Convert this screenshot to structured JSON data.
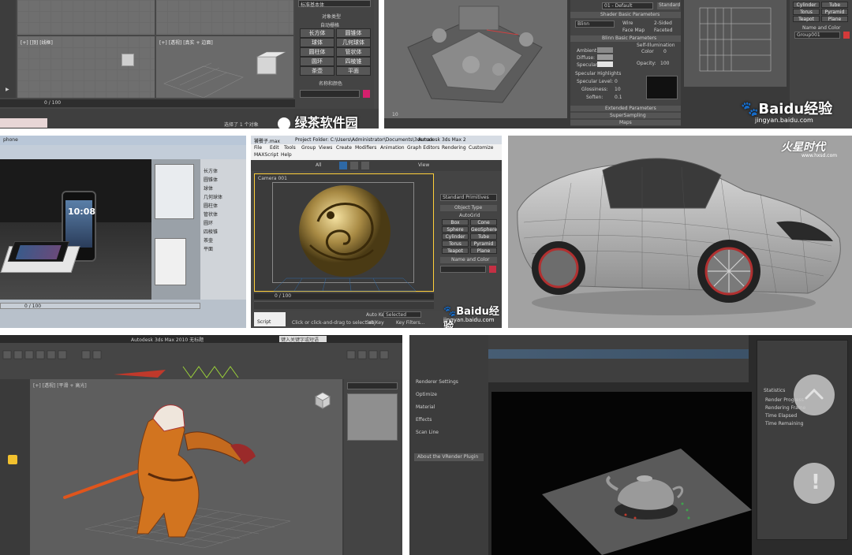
{
  "tile1": {
    "dropdown_value": "标准基本体",
    "section_object_type": "对象类型",
    "autogrid_label": "自动栅格",
    "buttons": [
      "长方体",
      "圆锥体",
      "球体",
      "几何球体",
      "圆柱体",
      "管状体",
      "圆环",
      "四棱锥",
      "茶壶",
      "平面"
    ],
    "section_name_color": "名称和颜色",
    "viewport_label_top": "[+] [顶] [线框]",
    "viewport_label_persp": "[+] [透视] [真实 + 边面]",
    "timeline": "0 / 100",
    "status": "选择了 1 个对象",
    "watermark": "绿茶软件园"
  },
  "tile2": {
    "default_label": "01 - Default",
    "standard_label": "Standard",
    "shader_header": "Shader Basic Parameters",
    "shader_value": "Blinn",
    "wire": "Wire",
    "two_sided": "2-Sided",
    "face_map": "Face Map",
    "faceted": "Faceted",
    "blinn_header": "Blinn Basic Parameters",
    "self_illum": "Self-Illumination",
    "color": "Color",
    "color_val": "0",
    "ambient": "Ambient:",
    "diffuse": "Diffuse:",
    "specular": "Specular:",
    "opacity": "Opacity:",
    "opacity_val": "100",
    "spec_highlights": "Specular Highlights",
    "spec_level": "Specular Level:",
    "spec_level_val": "0",
    "glossiness": "Glossiness:",
    "glossiness_val": "10",
    "soften": "Soften:",
    "soften_val": "0.1",
    "extended": "Extended Parameters",
    "supersampling": "SuperSampling",
    "maps": "Maps",
    "right_items": [
      "Cylinder",
      "Tube",
      "Torus",
      "Pyramid",
      "Teapot",
      "Plane"
    ],
    "right_cone": "Cone",
    "name_color": "Name and Color",
    "group_name": "Group001",
    "watermark_main": "Baidu经验",
    "watermark_url": "jingyan.baidu.com"
  },
  "tile3": {
    "title": "phone",
    "phone_time": "10:08",
    "menu_items": [
      "长方体",
      "圆锥体",
      "球体",
      "几何球体",
      "圆柱体",
      "管状体",
      "圆环",
      "四棱锥",
      "茶壶",
      "平面"
    ],
    "frame": "0 / 100"
  },
  "tile4": {
    "title_file": "饕餮子.max",
    "title_path": "Project Folder: C:\\Users\\Administrator\\Documents\\3dsmax",
    "title_app": "Autodesk 3ds Max 2",
    "menu": [
      "File",
      "Edit",
      "Tools",
      "Group",
      "Views",
      "Create",
      "Modifiers",
      "Animation",
      "Graph Editors",
      "Rendering",
      "Customize"
    ],
    "menu2": [
      "MAXScript",
      "Help"
    ],
    "toolbar_all": "All",
    "toolbar_view": "View",
    "viewport_label": "Camera 001",
    "dropdown": "Standard Primitives",
    "object_type": "Object Type",
    "autogrid": "AutoGrid",
    "primitives": [
      "Box",
      "Cone",
      "Sphere",
      "GeoSphere",
      "Cylinder",
      "Tube",
      "Torus",
      "Pyramid",
      "Teapot",
      "Plane"
    ],
    "name_color": "Name and Color",
    "timeline": "0 / 100",
    "script": "Script",
    "status": "Click or click-and-drag to select obj",
    "auto_key": "Auto Key",
    "selected": "Selected",
    "set_key": "Set Key",
    "key_filters": "Key Filters...",
    "watermark_main": "Baidu经验",
    "watermark_url": "jingyan.baidu.com"
  },
  "tile5": {
    "brand": "火星时代",
    "url": "www.hxsd.com"
  },
  "tile6": {
    "title": "Autodesk 3ds Max 2010   无标题",
    "search": "键入关键字或短语",
    "viewport_label": "[+] [透视] [平滑 + 高光]"
  },
  "tile7": {
    "panel_items": [
      "Renderer Settings",
      "Optimize",
      "Material",
      "Effects",
      "Scan Line"
    ],
    "about": "About the VRender Plugin",
    "right_header": "Statistics",
    "right_lines": [
      "Render Progress",
      "Rendering Frame",
      "Time Elapsed",
      "Time Remaining"
    ]
  },
  "colors": {
    "max_dark": "#3d3d3d",
    "max_panel": "#444444",
    "max_button": "#585858",
    "select_blue": "#2e69a6",
    "baidu_blue": "#2a6fd1",
    "hxsd_gray": "#9a9a9a",
    "fab": "#c8c8c8"
  },
  "icons": {
    "fab_up": "chevron-up-icon",
    "fab_alert": "exclamation-icon",
    "paw": "baidu-paw-icon"
  }
}
